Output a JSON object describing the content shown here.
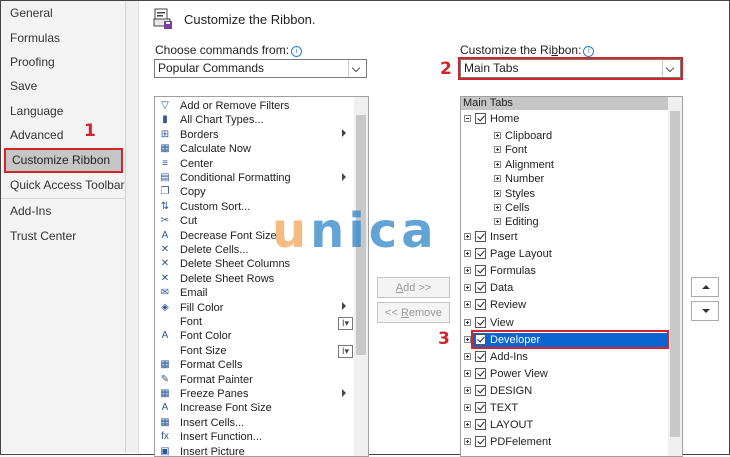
{
  "nav": {
    "items": [
      "General",
      "Formulas",
      "Proofing",
      "Save",
      "Language",
      "Advanced",
      "Customize Ribbon",
      "Quick Access Toolbar",
      "Add-Ins",
      "Trust Center"
    ]
  },
  "markers": {
    "one": "1",
    "two": "2",
    "three": "3"
  },
  "header": {
    "title": "Customize the Ribbon."
  },
  "left_panel": {
    "label_pre": "Choose commands from:",
    "info": "i",
    "combo_value": "Popular Commands",
    "commands": [
      {
        "icon": "filter-icon",
        "glyph": "▽",
        "label": "Add or Remove Filters"
      },
      {
        "icon": "chart-icon",
        "glyph": "▮",
        "label": "All Chart Types..."
      },
      {
        "icon": "borders-icon",
        "glyph": "⊞",
        "label": "Borders"
      },
      {
        "icon": "calculator-icon",
        "glyph": "▦",
        "label": "Calculate Now"
      },
      {
        "icon": "center-icon",
        "glyph": "≡",
        "label": "Center"
      },
      {
        "icon": "conditional-format-icon",
        "glyph": "▤",
        "label": "Conditional Formatting"
      },
      {
        "icon": "copy-icon",
        "glyph": "❐",
        "label": "Copy"
      },
      {
        "icon": "sort-icon",
        "glyph": "⇅",
        "label": "Custom Sort..."
      },
      {
        "icon": "cut-icon",
        "glyph": "✂",
        "label": "Cut"
      },
      {
        "icon": "decrease-font-icon",
        "glyph": "A",
        "label": "Decrease Font Size"
      },
      {
        "icon": "delete-cells-icon",
        "glyph": "✕",
        "label": "Delete Cells..."
      },
      {
        "icon": "delete-columns-icon",
        "glyph": "✕",
        "label": "Delete Sheet Columns"
      },
      {
        "icon": "delete-rows-icon",
        "glyph": "✕",
        "label": "Delete Sheet Rows"
      },
      {
        "icon": "email-icon",
        "glyph": "✉",
        "label": "Email"
      },
      {
        "icon": "fill-color-icon",
        "glyph": "◈",
        "label": "Fill Color"
      },
      {
        "icon": "font-icon",
        "glyph": "",
        "label": "Font"
      },
      {
        "icon": "font-color-icon",
        "glyph": "A",
        "label": "Font Color"
      },
      {
        "icon": "font-size-icon",
        "glyph": "",
        "label": "Font Size"
      },
      {
        "icon": "format-cells-icon",
        "glyph": "▦",
        "label": "Format Cells"
      },
      {
        "icon": "format-painter-icon",
        "glyph": "✎",
        "label": "Format Painter"
      },
      {
        "icon": "freeze-panes-icon",
        "glyph": "▦",
        "label": "Freeze Panes"
      },
      {
        "icon": "increase-font-icon",
        "glyph": "A",
        "label": "Increase Font Size"
      },
      {
        "icon": "insert-cells-icon",
        "glyph": "▦",
        "label": "Insert Cells..."
      },
      {
        "icon": "insert-function-icon",
        "glyph": "fx",
        "label": "Insert Function..."
      },
      {
        "icon": "insert-picture-icon",
        "glyph": "▣",
        "label": "Insert Picture"
      }
    ]
  },
  "buttons": {
    "add_u": "A",
    "add_rest": "dd >>",
    "remove_pre": "<< ",
    "remove_u": "R",
    "remove_rest": "emove"
  },
  "right_panel": {
    "label_pre": "Customize the Ri",
    "label_u": "b",
    "label_post": "bon:",
    "info": "i",
    "combo_value": "Main Tabs",
    "tree_header": "Main Tabs",
    "home": "Home",
    "home_children": [
      "Clipboard",
      "Font",
      "Alignment",
      "Number",
      "Styles",
      "Cells",
      "Editing"
    ],
    "tabs": [
      "Insert",
      "Page Layout",
      "Formulas",
      "Data",
      "Review",
      "View",
      "Developer",
      "Add-Ins",
      "Power View",
      "DESIGN",
      "TEXT",
      "LAYOUT",
      "PDFelement"
    ]
  },
  "watermark": {
    "u": "u",
    "nica": "nica",
    "u_color": "#f3a35a",
    "nica_color": "#2f86c9"
  }
}
